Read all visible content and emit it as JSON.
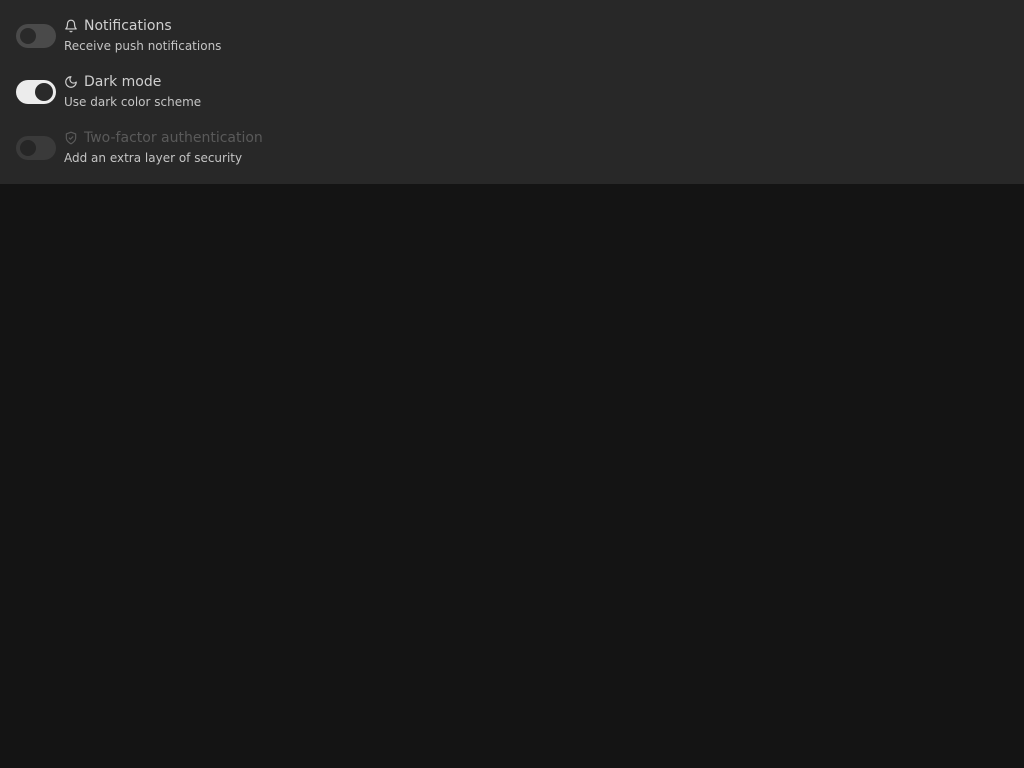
{
  "settings": [
    {
      "icon": "bell-icon",
      "title": "Notifications",
      "description": "Receive push notifications",
      "enabled": false,
      "disabled": false
    },
    {
      "icon": "moon-icon",
      "title": "Dark mode",
      "description": "Use dark color scheme",
      "enabled": true,
      "disabled": false
    },
    {
      "icon": "shield-check-icon",
      "title": "Two-factor authentication",
      "description": "Add an extra layer of security",
      "enabled": false,
      "disabled": true
    }
  ],
  "colors": {
    "panel_background": "#282828",
    "page_background": "#141414",
    "toggle_on": "#ececec",
    "toggle_off": "#4a4a4a",
    "toggle_disabled": "#3a3a3a"
  }
}
